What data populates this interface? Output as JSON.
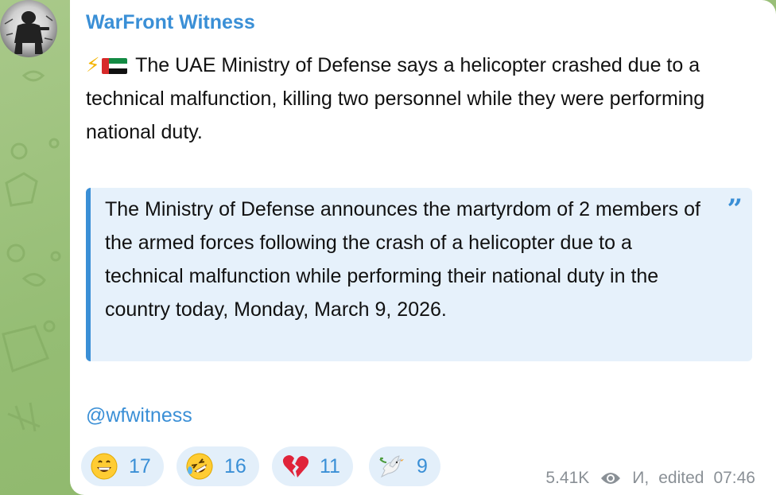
{
  "channel": {
    "name": "WarFront Witness",
    "avatar_icon": "soldier-avatar-icon"
  },
  "post": {
    "prefix_icons": [
      "lightning-icon",
      "uae-flag-icon"
    ],
    "text": "The UAE Ministry of Defense says a helicopter crashed due to a technical malfunction, killing two personnel while they were performing national duty.",
    "quote": "The Ministry of Defense announces the martyrdom of 2 members of the armed forces following the crash of a helicopter due to a technical malfunction while performing their national duty in the country today, Monday, March 9, 2026.",
    "handle": "@wfwitness"
  },
  "reactions": [
    {
      "emoji": "grinning-face",
      "count": "17"
    },
    {
      "emoji": "rolling-on-floor-laughing",
      "count": "16"
    },
    {
      "emoji": "broken-heart",
      "count": "11"
    },
    {
      "emoji": "dove",
      "count": "9"
    }
  ],
  "meta": {
    "views": "5.41K",
    "author": "И,",
    "edited_label": "edited",
    "time": "07:46"
  },
  "colors": {
    "accent": "#3a8fd6",
    "quote_bg": "#e6f1fb",
    "reaction_bg": "#e3effa",
    "meta_gray": "#8a9096",
    "wallpaper": "#95bd74"
  }
}
